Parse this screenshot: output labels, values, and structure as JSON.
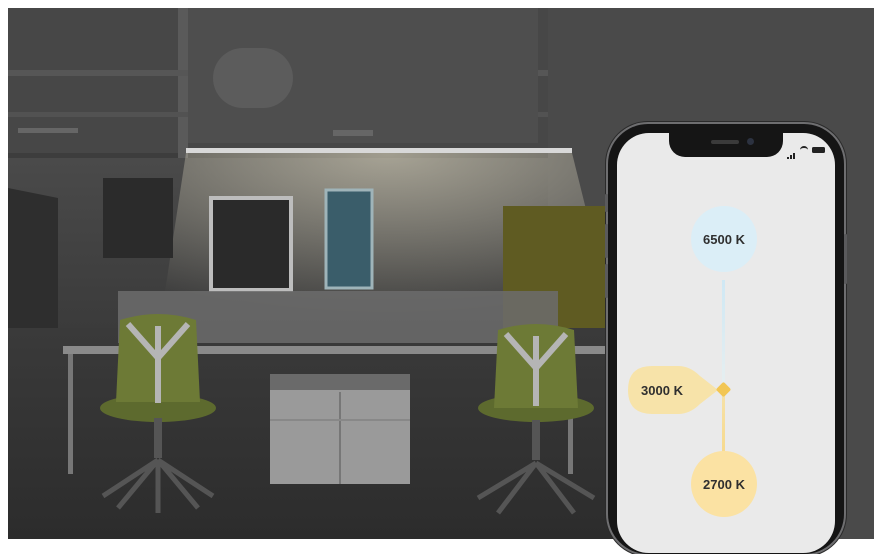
{
  "app": {
    "scene_description_alt": "",
    "colors": {
      "cool": "#dbeef7",
      "warm": "#fbe2a3",
      "accent": "#f2c654",
      "screen": "#eaeaea"
    }
  },
  "phone": {
    "status_icons": [
      "signal-icon",
      "wifi-icon",
      "battery-icon"
    ],
    "color_temp": {
      "cool_label": "6500 K",
      "current_label": "3000 K",
      "warm_label": "2700 K",
      "current_value_kelvin": 3000,
      "min_kelvin": 2700,
      "max_kelvin": 6500
    }
  }
}
